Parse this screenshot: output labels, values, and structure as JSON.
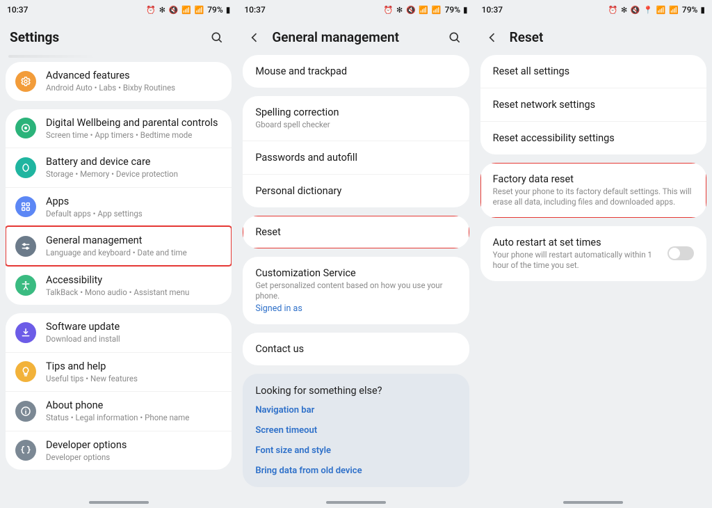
{
  "status": {
    "time": "10:37",
    "battery": "79%"
  },
  "panel1": {
    "title": "Settings",
    "groups": [
      {
        "items": [
          {
            "iconClass": "ic-orange",
            "iconName": "gear-icon",
            "title": "Advanced features",
            "sub": "Android Auto  •  Labs  •  Bixby Routines"
          }
        ]
      },
      {
        "items": [
          {
            "iconClass": "ic-green",
            "iconName": "wellbeing-icon",
            "title": "Digital Wellbeing and parental controls",
            "sub": "Screen time  •  App timers  •  Bedtime mode"
          },
          {
            "iconClass": "ic-teal",
            "iconName": "battery-icon",
            "title": "Battery and device care",
            "sub": "Storage  •  Memory  •  Device protection"
          },
          {
            "iconClass": "ic-blue",
            "iconName": "apps-icon",
            "title": "Apps",
            "sub": "Default apps  •  App settings"
          },
          {
            "iconClass": "ic-slate",
            "iconName": "sliders-icon",
            "title": "General management",
            "sub": "Language and keyboard  •  Date and time",
            "highlight": true
          },
          {
            "iconClass": "ic-greenlt",
            "iconName": "accessibility-icon",
            "title": "Accessibility",
            "sub": "TalkBack  •  Mono audio  •  Assistant menu"
          }
        ]
      },
      {
        "items": [
          {
            "iconClass": "ic-purple",
            "iconName": "download-icon",
            "title": "Software update",
            "sub": "Download and install"
          },
          {
            "iconClass": "ic-yellow",
            "iconName": "lightbulb-icon",
            "title": "Tips and help",
            "sub": "Useful tips  •  New features"
          },
          {
            "iconClass": "ic-grey",
            "iconName": "info-icon",
            "title": "About phone",
            "sub": "Status  •  Legal information  •  Phone name"
          },
          {
            "iconClass": "ic-grey",
            "iconName": "braces-icon",
            "title": "Developer options",
            "sub": "Developer options"
          }
        ]
      }
    ]
  },
  "panel2": {
    "title": "General management",
    "groups": [
      {
        "items": [
          {
            "title": "Mouse and trackpad"
          }
        ]
      },
      {
        "items": [
          {
            "title": "Spelling correction",
            "sub": "Gboard spell checker"
          },
          {
            "title": "Passwords and autofill"
          },
          {
            "title": "Personal dictionary"
          }
        ]
      },
      {
        "items": [
          {
            "title": "Reset",
            "highlight": true
          }
        ]
      },
      {
        "items": [
          {
            "title": "Customization Service",
            "sub": "Get personalized content based on how you use your phone.",
            "link": "Signed in as"
          }
        ]
      },
      {
        "items": [
          {
            "title": "Contact us"
          }
        ]
      }
    ],
    "lookingFor": {
      "title": "Looking for something else?",
      "links": [
        "Navigation bar",
        "Screen timeout",
        "Font size and style",
        "Bring data from old device"
      ]
    }
  },
  "panel3": {
    "title": "Reset",
    "groups": [
      {
        "items": [
          {
            "title": "Reset all settings"
          },
          {
            "title": "Reset network settings"
          },
          {
            "title": "Reset accessibility settings"
          }
        ]
      },
      {
        "items": [
          {
            "title": "Factory data reset",
            "sub": "Reset your phone to its factory default settings. This will erase all data, including files and downloaded apps.",
            "highlight": true
          }
        ]
      },
      {
        "items": [
          {
            "title": "Auto restart at set times",
            "sub": "Your phone will restart automatically within 1 hour of the time you set.",
            "toggle": true
          }
        ]
      }
    ]
  }
}
